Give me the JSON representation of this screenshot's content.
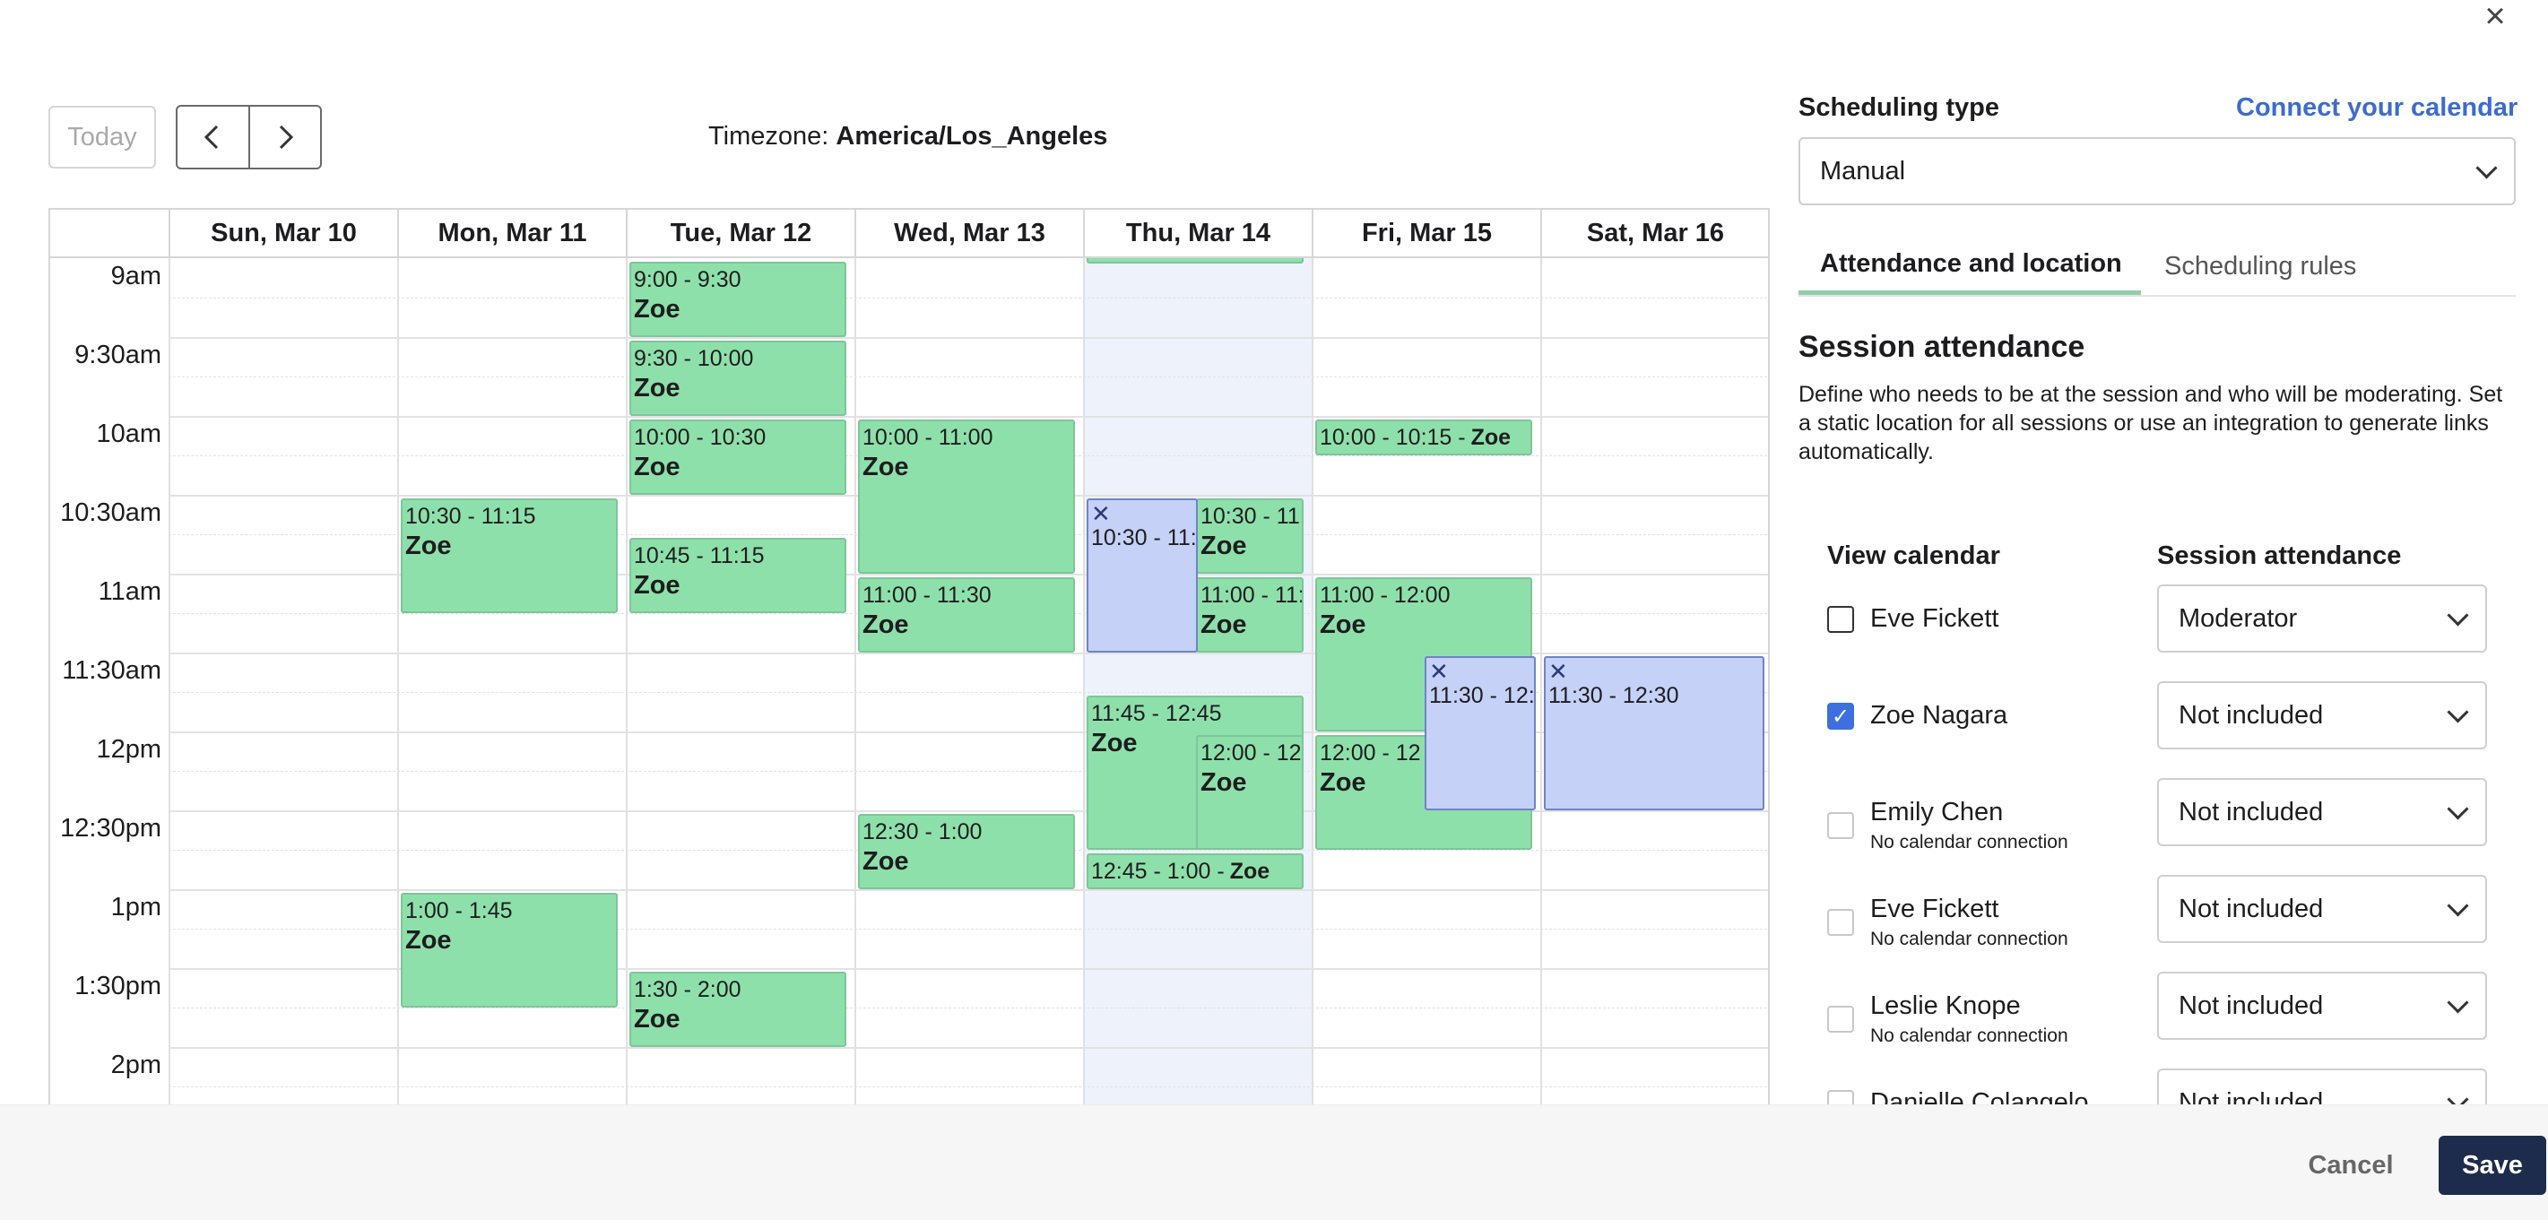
{
  "dialog": {
    "close_label": "×"
  },
  "toolbar": {
    "today_label": "Today",
    "prev_icon": "chevron-left",
    "next_icon": "chevron-right",
    "timezone_label": "Timezone:",
    "timezone_value": "America/Los_Angeles"
  },
  "calendar": {
    "days": [
      "Sun, Mar 10",
      "Mon, Mar 11",
      "Tue, Mar 12",
      "Wed, Mar 13",
      "Thu, Mar 14",
      "Fri, Mar 15",
      "Sat, Mar 16"
    ],
    "today_index": 4,
    "time_labels": [
      "9am",
      "9:30am",
      "10am",
      "10:30am",
      "11am",
      "11:30am",
      "12pm",
      "12:30pm",
      "1pm",
      "1:30pm",
      "2pm"
    ],
    "colors": {
      "event_green": "#8ee0ab",
      "event_blue": "#c5d1f7",
      "today_bg": "#eef2fb"
    },
    "events": [
      {
        "day": 2,
        "time": "9:00 - 9:30",
        "name": "Zoe",
        "type": "green"
      },
      {
        "day": 2,
        "time": "9:30 - 10:00",
        "name": "Zoe",
        "type": "green"
      },
      {
        "day": 2,
        "time": "10:00 - 10:30",
        "name": "Zoe",
        "type": "green"
      },
      {
        "day": 2,
        "time": "10:45 - 11:15",
        "name": "Zoe",
        "type": "green"
      },
      {
        "day": 2,
        "time": "1:30 - 2:00",
        "name": "Zoe",
        "type": "green"
      },
      {
        "day": 1,
        "time": "10:30 - 11:15",
        "name": "Zoe",
        "type": "green"
      },
      {
        "day": 1,
        "time": "1:00 - 1:45",
        "name": "Zoe",
        "type": "green"
      },
      {
        "day": 3,
        "time": "10:00 - 11:00",
        "name": "Zoe",
        "type": "green"
      },
      {
        "day": 3,
        "time": "11:00 - 11:30",
        "name": "Zoe",
        "type": "green"
      },
      {
        "day": 3,
        "time": "12:30 - 1:00",
        "name": "Zoe",
        "type": "green"
      },
      {
        "day": 4,
        "time": "",
        "name": "",
        "type": "green"
      },
      {
        "day": 4,
        "time": "10:30 - 11:",
        "name": "",
        "type": "blue",
        "x": "✕"
      },
      {
        "day": 4,
        "time": "10:30 - 11:",
        "name": "Zoe",
        "type": "green"
      },
      {
        "day": 4,
        "time": "11:00 - 11:",
        "name": "Zoe",
        "type": "green"
      },
      {
        "day": 4,
        "time": "11:45 - 12:45",
        "name": "Zoe",
        "type": "green"
      },
      {
        "day": 4,
        "time": "12:00 - 12",
        "name": "Zoe",
        "type": "green"
      },
      {
        "day": 4,
        "time": "12:45 - 1:00 -",
        "name": "Zoe",
        "type": "green"
      },
      {
        "day": 5,
        "time": "10:00 - 10:15 -",
        "name": "Zoe",
        "type": "green"
      },
      {
        "day": 5,
        "time": "11:00 - 12:00",
        "name": "Zoe",
        "type": "green"
      },
      {
        "day": 5,
        "time": "12:00 - 12",
        "name": "Zoe",
        "type": "green"
      },
      {
        "day": 5,
        "time": "11:30 - 12:",
        "name": "",
        "type": "blue",
        "x": "✕"
      },
      {
        "day": 6,
        "time": "11:30 - 12:30",
        "name": "",
        "type": "blue",
        "x": "✕"
      }
    ]
  },
  "panel": {
    "scheduling_type_label": "Scheduling type",
    "connect_link": "Connect your calendar",
    "scheduling_type_value": "Manual",
    "tabs": [
      "Attendance and location",
      "Scheduling rules"
    ],
    "section_title": "Session attendance",
    "section_description": "Define who needs to be at the session and who will be moderating. Set a static location for all sessions or use an integration to generate links automatically.",
    "col_view_calendar": "View calendar",
    "col_session_attendance": "Session attendance",
    "people": [
      {
        "name": "Eve Fickett",
        "sub": "",
        "checked": false,
        "disabled": false,
        "attendance": "Moderator"
      },
      {
        "name": "Zoe Nagara",
        "sub": "",
        "checked": true,
        "disabled": false,
        "attendance": "Not included"
      },
      {
        "name": "Emily Chen",
        "sub": "No calendar connection",
        "checked": false,
        "disabled": true,
        "attendance": "Not included"
      },
      {
        "name": "Eve Fickett",
        "sub": "No calendar connection",
        "checked": false,
        "disabled": true,
        "attendance": "Not included"
      },
      {
        "name": "Leslie Knope",
        "sub": "No calendar connection",
        "checked": false,
        "disabled": true,
        "attendance": "Not included"
      },
      {
        "name": "Danielle Colangelo",
        "sub": "",
        "checked": false,
        "disabled": true,
        "attendance": "Not included"
      }
    ]
  },
  "footer": {
    "cancel_label": "Cancel",
    "save_label": "Save"
  }
}
